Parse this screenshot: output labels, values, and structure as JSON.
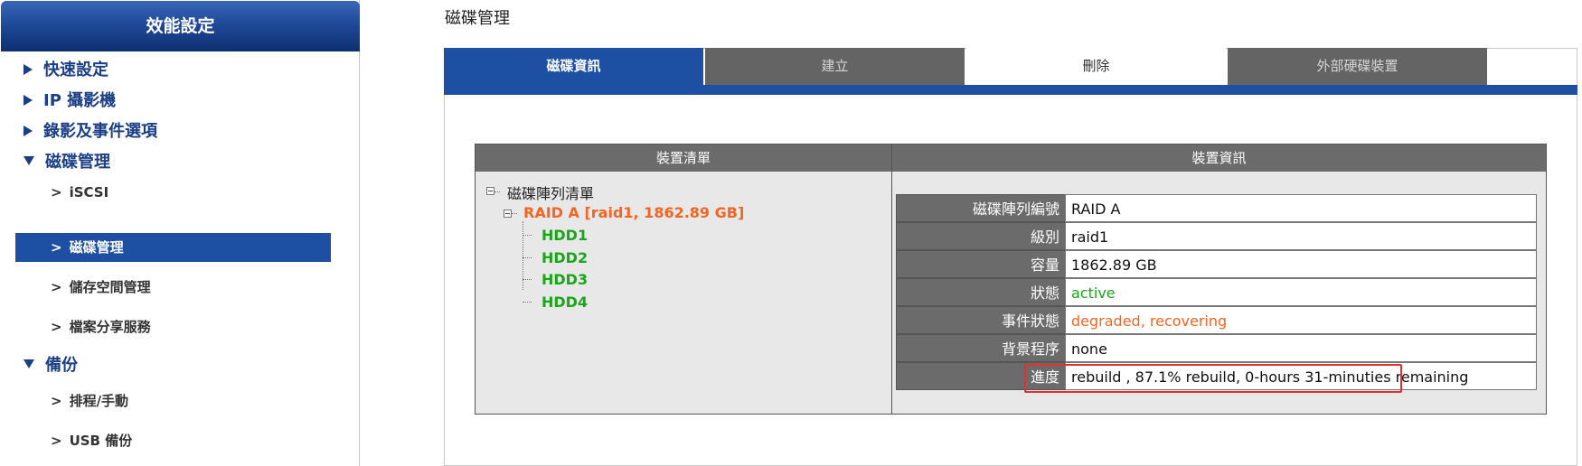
{
  "sidebar": {
    "title": "效能設定",
    "items": [
      {
        "label": "快速設定",
        "expanded": false
      },
      {
        "label": "IP 攝影機",
        "expanded": false
      },
      {
        "label": "錄影及事件選項",
        "expanded": false
      },
      {
        "label": "磁碟管理",
        "expanded": true,
        "children": [
          "iSCSI",
          "磁碟管理",
          "儲存空間管理",
          "檔案分享服務"
        ]
      },
      {
        "label": "備份",
        "expanded": true,
        "children": [
          "排程/手動",
          "USB 備份"
        ]
      }
    ],
    "active_child": "磁碟管理"
  },
  "page_title": "磁碟管理",
  "tabs": [
    {
      "label": "磁碟資訊",
      "active": true
    },
    {
      "label": "建立",
      "active": false
    },
    {
      "label": "刪除",
      "active": false
    },
    {
      "label": "外部硬碟裝置",
      "active": false
    }
  ],
  "device_table": {
    "col1_header": "裝置清單",
    "col2_header": "裝置資訊",
    "tree": {
      "root": "磁碟陣列清單",
      "raid": "RAID A [raid1, 1862.89 GB]",
      "disks": [
        "HDD1",
        "HDD2",
        "HDD3",
        "HDD4"
      ]
    },
    "info": [
      {
        "key": "磁碟陣列編號",
        "value": "RAID A",
        "color": "#111111"
      },
      {
        "key": "級別",
        "value": "raid1",
        "color": "#111111"
      },
      {
        "key": "容量",
        "value": "1862.89 GB",
        "color": "#111111"
      },
      {
        "key": "狀態",
        "value": "active",
        "color": "#1aa51a"
      },
      {
        "key": "事件狀態",
        "value": "degraded, recovering",
        "color": "#f26522"
      },
      {
        "key": "背景程序",
        "value": "none",
        "color": "#111111"
      },
      {
        "key": "進度",
        "value": "rebuild , 87.1% rebuild, 0-hours 31-minuties remaining",
        "color": "#111111"
      }
    ]
  },
  "colors": {
    "accent": "#1d4fa3",
    "raid": "#f26522",
    "ok": "#1aa51a",
    "highlight": "#e03030"
  }
}
